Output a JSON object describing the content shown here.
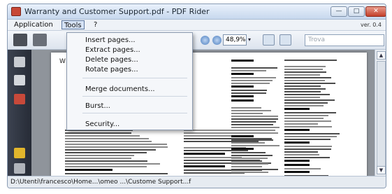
{
  "window": {
    "title": "Warranty and Customer Support.pdf - PDF Rider",
    "minimize_glyph": "—",
    "maximize_glyph": "□",
    "close_glyph": "✕"
  },
  "menubar": {
    "application": "Application",
    "tools": "Tools",
    "help": "?",
    "version": "ver. 0.4"
  },
  "toolbar": {
    "zoom_value": "48,9%",
    "zoom_arrow": "▾",
    "find_placeholder": "Trova"
  },
  "tools_menu": {
    "items": [
      "Insert pages...",
      "Extract pages...",
      "Delete pages...",
      "Rotate pages...",
      "Merge documents...",
      "Burst...",
      "Security..."
    ]
  },
  "document": {
    "page_label": "W"
  },
  "scrollbar": {
    "up": "▲",
    "down": "▼"
  },
  "status": {
    "path": "D:\\Utenti\\francesco\\Home...\\omeo  ...\\Custome  Support...f"
  },
  "icons": {
    "app": "pdf-rider-app-icon",
    "print": "printer-icon",
    "save": "save-icon",
    "zoom_out": "zoom-out-icon",
    "zoom_in": "zoom-in-icon",
    "fit_width": "fit-width-icon",
    "fit_page": "fit-page-icon",
    "side": [
      "pages-icon",
      "bookmarks-icon",
      "attachment-icon",
      "comments-icon",
      "paperclip-icon"
    ]
  },
  "colors": {
    "titlebar": "#c7d8ee",
    "side_panel": "#2f3540",
    "close_button": "#c4402a",
    "doc_background": "#8f949b"
  }
}
